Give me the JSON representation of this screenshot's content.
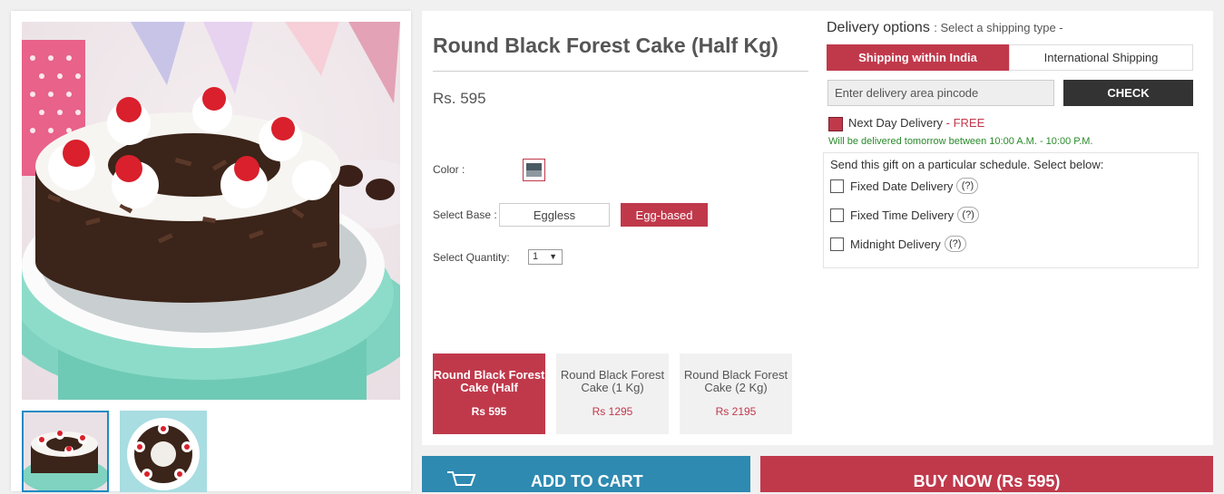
{
  "product": {
    "title": "Round Black Forest Cake (Half Kg)",
    "price": "Rs. 595",
    "color_label": "Color :",
    "base_label": "Select Base :",
    "base_options": [
      "Eggless",
      "Egg-based"
    ],
    "base_selected": "Egg-based",
    "quantity_label": "Select Quantity:",
    "quantity_value": "1",
    "variants": [
      {
        "name": "Round Black Forest Cake (Half",
        "price": "Rs 595",
        "active": true
      },
      {
        "name": "Round Black Forest Cake (1 Kg)",
        "price": "Rs 1295",
        "active": false
      },
      {
        "name": "Round Black Forest Cake (2 Kg)",
        "price": "Rs 2195",
        "active": false
      }
    ]
  },
  "delivery": {
    "heading": "Delivery options",
    "subheading": ": Select a shipping type -",
    "tabs": [
      "Shipping within India",
      "International Shipping"
    ],
    "pincode_placeholder": "Enter delivery area pincode",
    "check_label": "CHECK",
    "next_day_label": "Next Day Delivery",
    "next_day_free": " - FREE",
    "next_day_note": "Will be delivered tomorrow between 10:00 A.M. - 10:00 P.M.",
    "schedule_title": "Send this gift on a particular schedule. Select below:",
    "schedule_options": [
      "Fixed Date Delivery",
      "Fixed Time Delivery",
      "Midnight Delivery"
    ],
    "help_label": "(?)"
  },
  "actions": {
    "add_to_cart": "ADD TO CART",
    "buy_now": "BUY NOW (Rs 595)"
  },
  "colors": {
    "accent": "#c0394b",
    "cart_blue": "#2e8ab1",
    "success_green": "#2a8a2a",
    "dark": "#333333"
  }
}
